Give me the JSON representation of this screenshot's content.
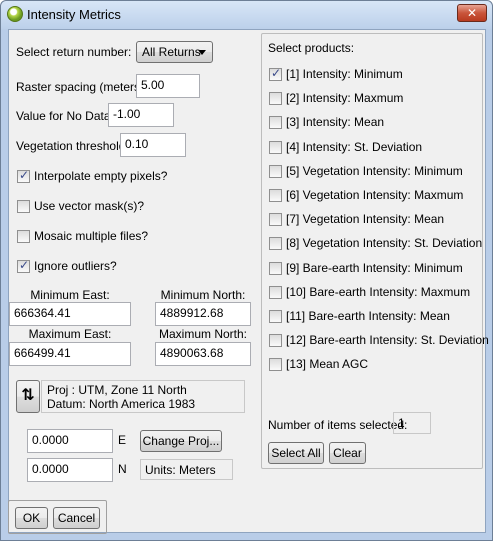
{
  "window": {
    "title": "Intensity Metrics",
    "close_label": "✕"
  },
  "left": {
    "return_label": "Select return number:",
    "return_value": "All Returns",
    "raster_label": "Raster spacing (meters):",
    "raster_value": "5.00",
    "nodata_label": "Value for No Data:",
    "nodata_value": "-1.00",
    "veg_label": "Vegetation threshold:",
    "veg_value": "0.10",
    "checks": [
      {
        "label": "Interpolate empty pixels?",
        "checked": true
      },
      {
        "label": "Use vector mask(s)?",
        "checked": false
      },
      {
        "label": "Mosaic multiple files?",
        "checked": false
      },
      {
        "label": "Ignore outliers?",
        "checked": true
      }
    ],
    "min_east_label": "Minimum East:",
    "min_east_value": "666364.41",
    "min_north_label": "Minimum North:",
    "min_north_value": "4889912.68",
    "max_east_label": "Maximum East:",
    "max_east_value": "666499.41",
    "max_north_label": "Maximum North:",
    "max_north_value": "4890063.68",
    "proj_line1": "Proj : UTM, Zone 11 North",
    "proj_line2": "Datum: North America 1983",
    "swap_glyph": "⇅",
    "east_offset_value": "0.0000",
    "east_offset_unit": "E",
    "north_offset_value": "0.0000",
    "north_offset_unit": "N",
    "change_proj_label": "Change Proj...",
    "units_label": "Units: Meters"
  },
  "right": {
    "header": "Select products:",
    "products": [
      {
        "label": "[1] Intensity: Minimum",
        "checked": true
      },
      {
        "label": "[2] Intensity: Maxmum",
        "checked": false
      },
      {
        "label": "[3] Intensity: Mean",
        "checked": false
      },
      {
        "label": "[4] Intensity: St. Deviation",
        "checked": false
      },
      {
        "label": "[5] Vegetation Intensity: Minimum",
        "checked": false
      },
      {
        "label": "[6] Vegetation Intensity: Maxmum",
        "checked": false
      },
      {
        "label": "[7] Vegetation Intensity: Mean",
        "checked": false
      },
      {
        "label": "[8] Vegetation Intensity: St. Deviation",
        "checked": false
      },
      {
        "label": "[9] Bare-earth Intensity: Minimum",
        "checked": false
      },
      {
        "label": "[10] Bare-earth Intensity: Maxmum",
        "checked": false
      },
      {
        "label": "[11] Bare-earth Intensity: Mean",
        "checked": false
      },
      {
        "label": "[12] Bare-earth Intensity: St. Deviation",
        "checked": false
      },
      {
        "label": "[13] Mean AGC",
        "checked": false
      }
    ],
    "count_label": "Number of items selected:",
    "count_value": "1",
    "select_all_label": "Select All",
    "clear_label": "Clear"
  },
  "footer": {
    "ok_label": "OK",
    "cancel_label": "Cancel"
  }
}
